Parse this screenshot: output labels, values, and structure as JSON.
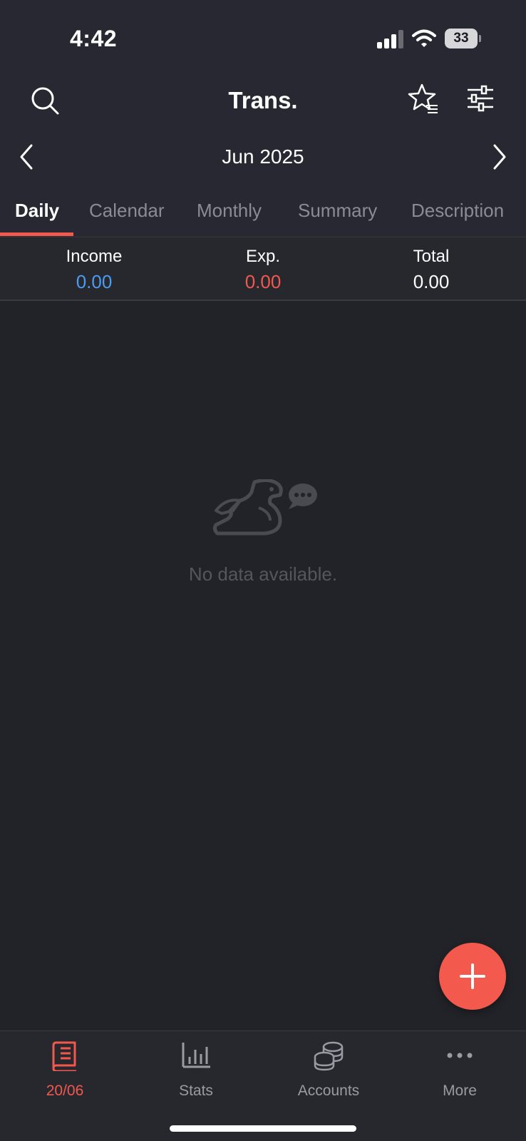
{
  "status_bar": {
    "time": "4:42",
    "battery": "33"
  },
  "header": {
    "title": "Trans."
  },
  "period": {
    "label": "Jun 2025"
  },
  "tabs": [
    {
      "label": "Daily",
      "active": true
    },
    {
      "label": "Calendar",
      "active": false
    },
    {
      "label": "Monthly",
      "active": false
    },
    {
      "label": "Summary",
      "active": false
    },
    {
      "label": "Description",
      "active": false
    }
  ],
  "summary": {
    "income": {
      "label": "Income",
      "value": "0.00"
    },
    "expense": {
      "label": "Exp.",
      "value": "0.00"
    },
    "total": {
      "label": "Total",
      "value": "0.00"
    }
  },
  "empty_state": {
    "message": "No data available."
  },
  "bottom_nav": [
    {
      "label": "20/06",
      "icon": "book-icon",
      "active": true
    },
    {
      "label": "Stats",
      "icon": "bar-chart-icon",
      "active": false
    },
    {
      "label": "Accounts",
      "icon": "coins-icon",
      "active": false
    },
    {
      "label": "More",
      "icon": "more-dots-icon",
      "active": false
    }
  ],
  "colors": {
    "accent": "#f2584e",
    "income": "#4b9bf0",
    "background": "#222328",
    "header_background": "#272831"
  }
}
